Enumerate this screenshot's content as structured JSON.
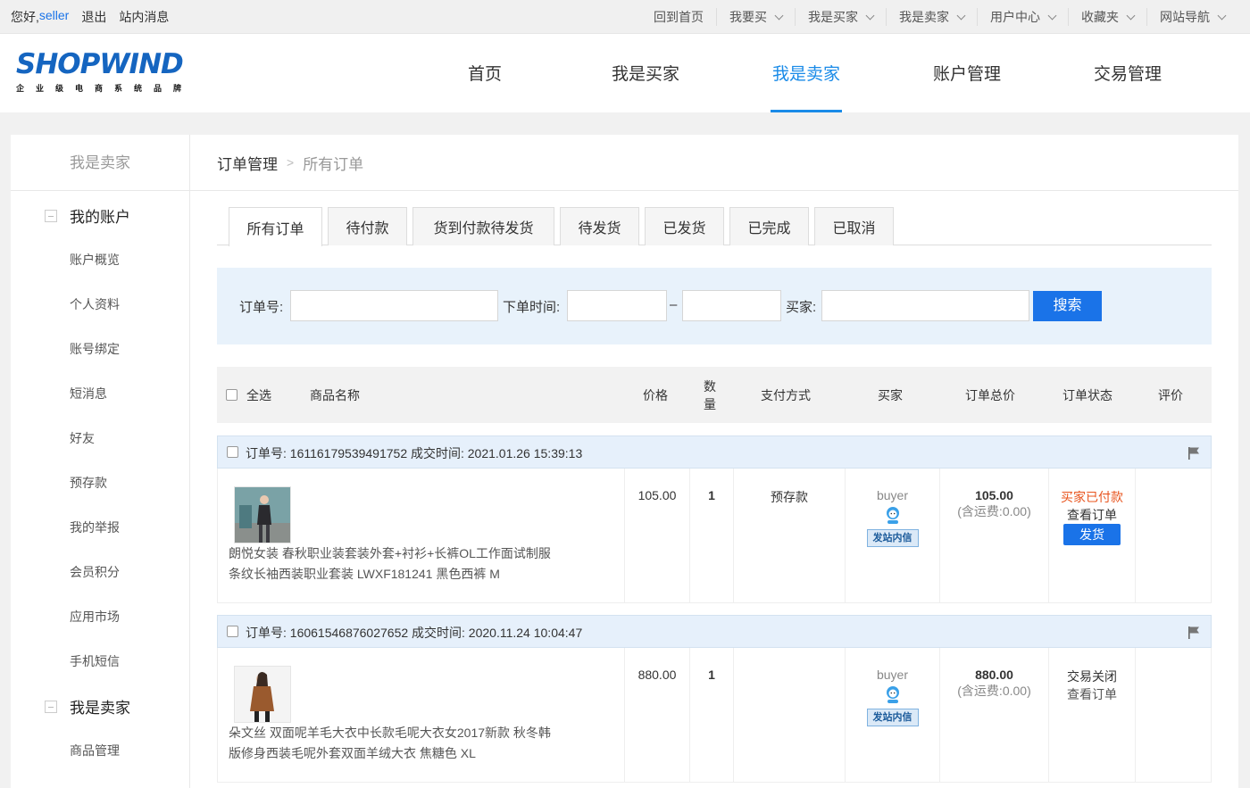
{
  "topbar": {
    "hello": "您好,",
    "username": "seller",
    "logout": "退出",
    "messages": "站内消息",
    "links": [
      {
        "label": "回到首页",
        "dropdown": false
      },
      {
        "label": "我要买",
        "dropdown": true
      },
      {
        "label": "我是买家",
        "dropdown": true
      },
      {
        "label": "我是卖家",
        "dropdown": true
      },
      {
        "label": "用户中心",
        "dropdown": true
      },
      {
        "label": "收藏夹",
        "dropdown": true
      },
      {
        "label": "网站导航",
        "dropdown": true
      }
    ]
  },
  "logo": {
    "word": "SHOPWIND",
    "slogan": "企业级电商系统品牌"
  },
  "mainnav": [
    "首页",
    "我是买家",
    "我是卖家",
    "账户管理",
    "交易管理"
  ],
  "mainnav_active": "我是卖家",
  "sidebar": {
    "title": "我是卖家",
    "group1": "我的账户",
    "items": [
      "账户概览",
      "个人资料",
      "账号绑定",
      "短消息",
      "好友",
      "预存款",
      "我的举报",
      "会员积分",
      "应用市场",
      "手机短信"
    ],
    "group2": "我是卖家",
    "group2_items": [
      "商品管理"
    ]
  },
  "breadcrumb": {
    "section": "订单管理",
    "current": "所有订单"
  },
  "tabs": [
    "所有订单",
    "待付款",
    "货到付款待发货",
    "待发货",
    "已发货",
    "已完成",
    "已取消"
  ],
  "tab_active": "所有订单",
  "search": {
    "order_no_label": "订单号:",
    "time_label": "下单时间:",
    "dash": "–",
    "buyer_label": "买家:",
    "button": "搜索"
  },
  "table_header": {
    "select_all": "全选",
    "product": "商品名称",
    "price": "价格",
    "qty_1": "数",
    "qty_2": "量",
    "payment": "支付方式",
    "buyer": "买家",
    "total": "订单总价",
    "status": "订单状态",
    "review": "评价"
  },
  "orders": [
    {
      "order_line": "订单号:  16116179539491752 成交时间:  2021.01.26 15:39:13",
      "product_name": "朗悦女装 春秋职业装套装外套+衬衫+长裤OL工作面试制服条纹长袖西装职业套装 LWXF181241 黑色西裤 M",
      "price": "105.00",
      "qty": "1",
      "payment": "预存款",
      "buyer": "buyer",
      "pm_badge": "发站内信",
      "total": "105.00",
      "shipping": "(含运费:0.00)",
      "status": "买家已付款",
      "view": "查看订单",
      "action": "发货"
    },
    {
      "order_line": "订单号:  16061546876027652 成交时间:  2020.11.24 10:04:47",
      "product_name": "朵文丝 双面呢羊毛大衣中长款毛呢大衣女2017新款 秋冬韩版修身西装毛呢外套双面羊绒大衣 焦糖色 XL",
      "price": "880.00",
      "qty": "1",
      "payment": "",
      "buyer": "buyer",
      "pm_badge": "发站内信",
      "total": "880.00",
      "shipping": "(含运费:0.00)",
      "status": "交易关闭",
      "view": "查看订单",
      "action": ""
    }
  ],
  "colors": {
    "accent": "#1a73e8",
    "nav_active": "#1a8be8",
    "status_paid": "#e8541e"
  }
}
